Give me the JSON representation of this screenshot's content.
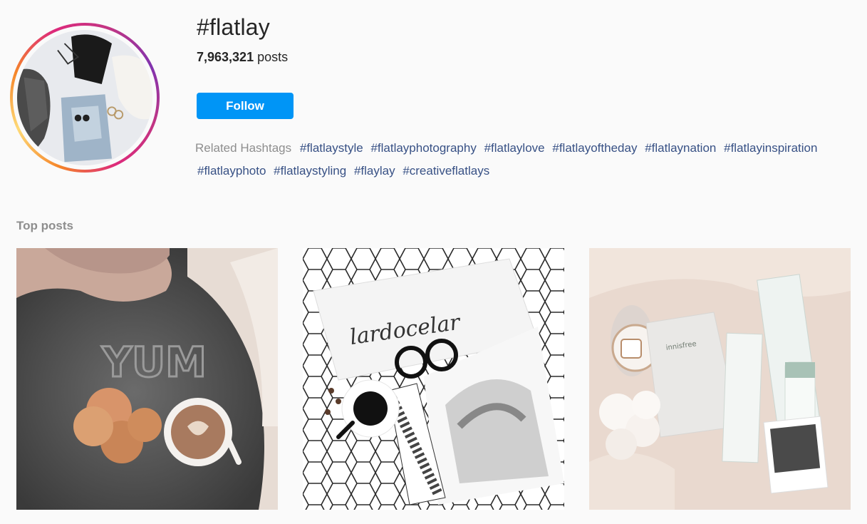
{
  "header": {
    "hashtag": "#flatlay",
    "post_count": "7,963,321",
    "post_label": "posts",
    "follow_label": "Follow"
  },
  "related": {
    "label": "Related Hashtags",
    "tags": [
      "#flatlaystyle",
      "#flatlayphotography",
      "#flatlaylove",
      "#flatlayoftheday",
      "#flatlaynation",
      "#flatlayinspiration",
      "#flatlayphoto",
      "#flatlaystyling",
      "#flaylay",
      "#creativeflatlays"
    ]
  },
  "top_posts": {
    "title": "Top posts",
    "posts": [
      {
        "image_text": "YUM"
      },
      {
        "image_text": "lardocelar"
      },
      {
        "image_text": "innisfree"
      }
    ]
  },
  "colors": {
    "accent": "#0095f6",
    "link": "#385185",
    "muted": "#8e8e8e",
    "background": "#fafafa"
  }
}
